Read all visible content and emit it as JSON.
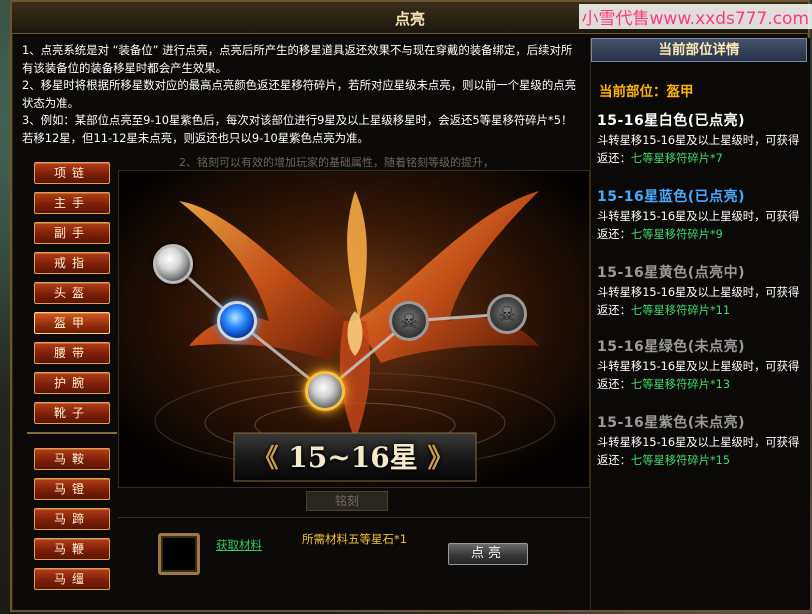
{
  "window": {
    "title": "点亮",
    "watermark": "小雪代售www.xxds777.com"
  },
  "intro": {
    "line1": "1、点亮系统是对 “装备位” 进行点亮，点亮后所产生的移星道具返还效果不与现在穿戴的装备绑定，后续对所有该装备位的装备移星时都会产生效果。",
    "line2": "2、移星时将根据所移星数对应的最高点亮颜色返还星移符碎片，若所对应星级未点亮，则以前一个星级的点亮状态为准。",
    "line3": "3、例如：某部位点亮至9-10星紫色后，每次对该部位进行9星及以上星级移星时，会返还5等星移符碎片*5！若移12星，但11-12星未点亮，则返还也只以9-10星紫色点亮为准。",
    "ghost_line": "2、铭刻可以有效的增加玩家的基础属性，随着铭刻等级的提升，"
  },
  "slots": [
    {
      "label": "项链"
    },
    {
      "label": "主手"
    },
    {
      "label": "副手"
    },
    {
      "label": "戒指"
    },
    {
      "label": "头盔"
    },
    {
      "label": "盔甲",
      "active": true
    },
    {
      "label": "腰带"
    },
    {
      "label": "护腕"
    },
    {
      "label": "靴子"
    },
    {
      "label": "马鞍"
    },
    {
      "label": "马镫"
    },
    {
      "label": "马蹄"
    },
    {
      "label": "马鞭"
    },
    {
      "label": "马缰"
    }
  ],
  "stage": {
    "label_left": "《",
    "label_text": "15~16星",
    "label_right": "》",
    "orbs": [
      {
        "state": "white"
      },
      {
        "state": "blue"
      },
      {
        "state": "yellow"
      },
      {
        "state": "locked"
      },
      {
        "state": "locked"
      }
    ]
  },
  "ghost_tab": "铭刻",
  "bottom": {
    "get_material": "获取材料",
    "required_material": "所需材料五等星石*1",
    "light_button": "点亮"
  },
  "detail": {
    "header": "当前部位详情",
    "current_part": "当前部位：盔甲",
    "tiers": [
      {
        "title": "15-16星白色(已点亮)",
        "color": "#ffffff",
        "desc": "斗转星移15-16星及以上星级时，可获得返还：",
        "reward": "七等星移符碎片*7"
      },
      {
        "title": "15-16星蓝色(已点亮)",
        "color": "#4aa8ff",
        "desc": "斗转星移15-16星及以上星级时，可获得返还：",
        "reward": "七等星移符碎片*9"
      },
      {
        "title": "15-16星黄色(点亮中)",
        "color": "#9a9a9a",
        "desc": "斗转星移15-16星及以上星级时，可获得返还：",
        "reward": "七等星移符碎片*11"
      },
      {
        "title": "15-16星绿色(未点亮)",
        "color": "#9a9a9a",
        "desc": "斗转星移15-16星及以上星级时，可获得返还：",
        "reward": "七等星移符碎片*13"
      },
      {
        "title": "15-16星紫色(未点亮)",
        "color": "#9a9a9a",
        "desc": "斗转星移15-16星及以上星级时，可获得返还：",
        "reward": "七等星移符碎片*15"
      }
    ]
  }
}
